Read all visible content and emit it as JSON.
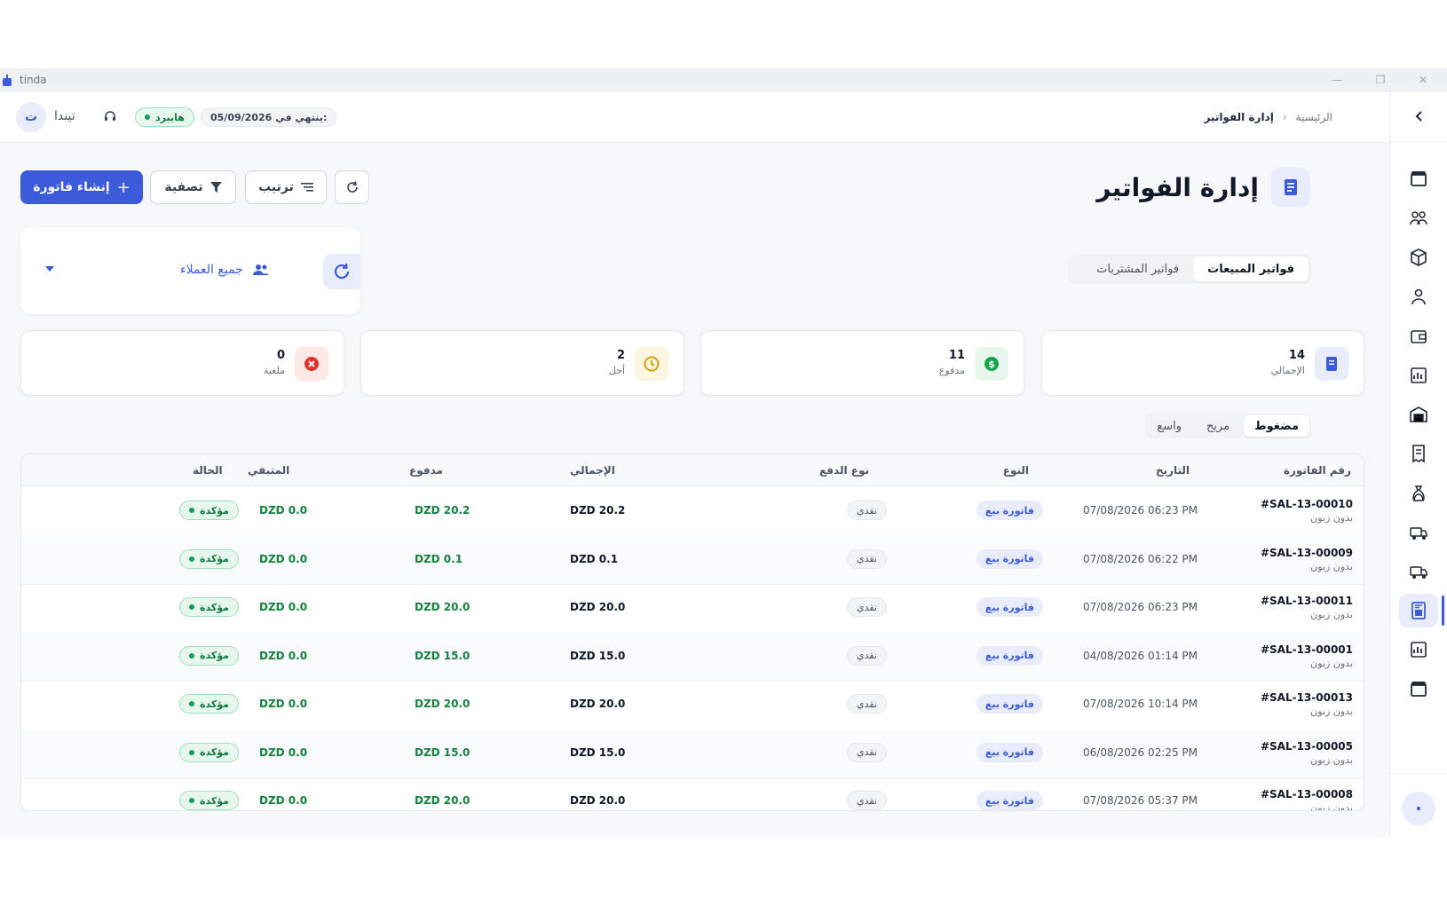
{
  "app": {
    "name": "tinda"
  },
  "header": {
    "avatar_letter": "ت",
    "user_name": "تيندا",
    "plan_badge": "هايبرد",
    "expiry_label": "ينتهي في:",
    "expiry_date": "05/09/2026",
    "breadcrumb": {
      "home": "الرئيسية",
      "separator": "‹",
      "current": "إدارة الفواتير"
    }
  },
  "page": {
    "title": "إدارة الفواتير",
    "create_button": "إنشاء فاتورة",
    "filter_button": "تصفية",
    "sort_button": "ترتيب",
    "tabs": [
      "فواتير المبيعات",
      "فواتير المشتريات"
    ],
    "active_tab": "فواتير المبيعات",
    "customer_filter": "جميع العملاء"
  },
  "stats": [
    {
      "value": "14",
      "label": "الإجمالي",
      "color": "#3b5bdb",
      "bg": "#e8ecfb",
      "icon": "invoice-icon"
    },
    {
      "value": "11",
      "label": "مدفوع",
      "color": "#16a34a",
      "bg": "#e7f7ee",
      "icon": "dollar-icon"
    },
    {
      "value": "2",
      "label": "أجل",
      "color": "#d6a10f",
      "bg": "#fdf6e0",
      "icon": "clock-icon"
    },
    {
      "value": "0",
      "label": "ملغية",
      "color": "#e03131",
      "bg": "#fde8e8",
      "icon": "cancel-icon"
    }
  ],
  "density": {
    "options": [
      "مضغوط",
      "مريح",
      "واسع"
    ],
    "active": "مضغوط"
  },
  "table": {
    "columns": {
      "invoice_no": "رقم الفاتورة",
      "date": "التاريخ",
      "type": "النوع",
      "payment_type": "نوع الدفع",
      "total": "الإجمالي",
      "paid": "مدفوع",
      "remaining": "المتبقي",
      "status": "الحالة"
    },
    "rows": [
      {
        "no": "#SAL-13-00010",
        "customer": "بدون زبون",
        "date": "07/08/2026 06:23 PM",
        "type": "فاتورة بيع",
        "pay": "نقدي",
        "total": "DZD 20.2",
        "paid": "DZD 20.2",
        "remaining": "DZD 0.0",
        "status": "مؤكدة"
      },
      {
        "no": "#SAL-13-00009",
        "customer": "بدون زبون",
        "date": "07/08/2026 06:22 PM",
        "type": "فاتورة بيع",
        "pay": "نقدي",
        "total": "DZD 0.1",
        "paid": "DZD 0.1",
        "remaining": "DZD 0.0",
        "status": "مؤكدة"
      },
      {
        "no": "#SAL-13-00011",
        "customer": "بدون زبون",
        "date": "07/08/2026 06:23 PM",
        "type": "فاتورة بيع",
        "pay": "نقدي",
        "total": "DZD 20.0",
        "paid": "DZD 20.0",
        "remaining": "DZD 0.0",
        "status": "مؤكدة"
      },
      {
        "no": "#SAL-13-00001",
        "customer": "بدون زبون",
        "date": "04/08/2026 01:14 PM",
        "type": "فاتورة بيع",
        "pay": "نقدي",
        "total": "DZD 15.0",
        "paid": "DZD 15.0",
        "remaining": "DZD 0.0",
        "status": "مؤكدة"
      },
      {
        "no": "#SAL-13-00013",
        "customer": "بدون زبون",
        "date": "07/08/2026 10:14 PM",
        "type": "فاتورة بيع",
        "pay": "نقدي",
        "total": "DZD 20.0",
        "paid": "DZD 20.0",
        "remaining": "DZD 0.0",
        "status": "مؤكدة"
      },
      {
        "no": "#SAL-13-00005",
        "customer": "بدون زبون",
        "date": "06/08/2026 02:25 PM",
        "type": "فاتورة بيع",
        "pay": "نقدي",
        "total": "DZD 15.0",
        "paid": "DZD 15.0",
        "remaining": "DZD 0.0",
        "status": "مؤكدة"
      },
      {
        "no": "#SAL-13-00008",
        "customer": "بدون زبون",
        "date": "07/08/2026 05:37 PM",
        "type": "فاتورة بيع",
        "pay": "نقدي",
        "total": "DZD 20.0",
        "paid": "DZD 20.0",
        "remaining": "DZD 0.0",
        "status": "مؤكدة"
      }
    ]
  },
  "sidebar": {
    "items": [
      {
        "icon": "store-icon"
      },
      {
        "icon": "customers-icon"
      },
      {
        "icon": "box-icon"
      },
      {
        "icon": "users-icon"
      },
      {
        "icon": "wallet-icon"
      },
      {
        "icon": "report-icon"
      },
      {
        "icon": "warehouse-icon"
      },
      {
        "icon": "receipt-icon"
      },
      {
        "icon": "money-bag-icon"
      },
      {
        "icon": "delivery-icon"
      },
      {
        "icon": "truck-icon"
      },
      {
        "icon": "invoices-icon",
        "active": true
      },
      {
        "icon": "analytics-icon"
      },
      {
        "icon": "shop-icon"
      }
    ]
  },
  "colors": {
    "primary": "#3b5bdb",
    "success": "#0f7a3d"
  }
}
